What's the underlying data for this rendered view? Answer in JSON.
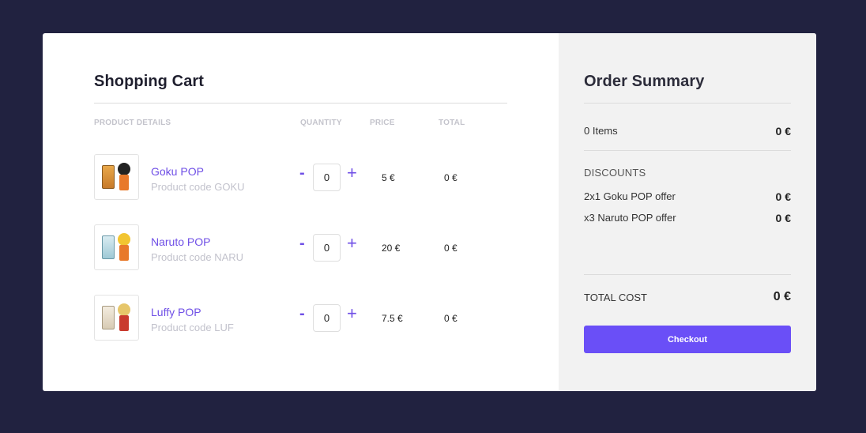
{
  "cart": {
    "title": "Shopping Cart",
    "columns": {
      "product": "PRODUCT DETAILS",
      "quantity": "QUANTITY",
      "price": "PRICE",
      "total": "TOTAL"
    },
    "items": [
      {
        "name": "Goku POP",
        "code": "Product code GOKU",
        "quantity": "0",
        "minus": "-",
        "plus": "+",
        "price": "5 €",
        "total": "0 €"
      },
      {
        "name": "Naruto POP",
        "code": "Product code NARU",
        "quantity": "0",
        "minus": "-",
        "plus": "+",
        "price": "20 €",
        "total": "0 €"
      },
      {
        "name": "Luffy POP",
        "code": "Product code LUF",
        "quantity": "0",
        "minus": "-",
        "plus": "+",
        "price": "7.5 €",
        "total": "0 €"
      }
    ]
  },
  "summary": {
    "title": "Order Summary",
    "items_label": "0 Items",
    "items_value": "0 €",
    "discounts_heading": "DISCOUNTS",
    "discounts": [
      {
        "label": "2x1 Goku POP offer",
        "value": "0 €"
      },
      {
        "label": "x3 Naruto POP offer",
        "value": "0 €"
      }
    ],
    "total_label": "TOTAL COST",
    "total_value": "0 €",
    "checkout_label": "Checkout"
  },
  "colors": {
    "background": "#212240",
    "accent": "#6a4ff7",
    "link": "#6f4fe6",
    "summary_bg": "#f2f2f2"
  }
}
